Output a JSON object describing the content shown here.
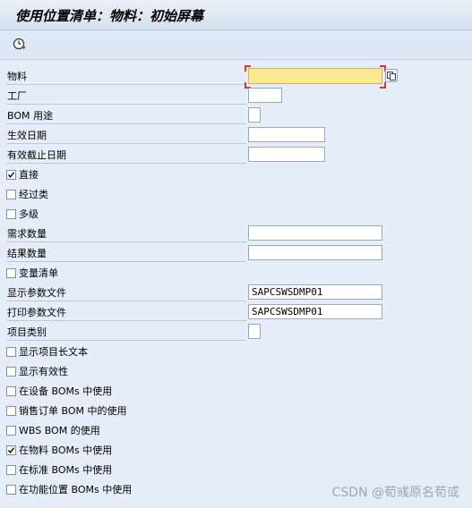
{
  "title": "使用位置清单：物料：初始屏幕",
  "toolbar": {
    "execute_icon": "execute-clock-icon"
  },
  "fields": {
    "material": {
      "label": "物料",
      "value": ""
    },
    "plant": {
      "label": "工厂",
      "value": ""
    },
    "bom_usage": {
      "label": "BOM 用途",
      "value": ""
    },
    "valid_from": {
      "label": "生效日期",
      "value": ""
    },
    "valid_to": {
      "label": "有效截止日期",
      "value": ""
    },
    "direct": {
      "label": "直接",
      "checked": true
    },
    "via_class": {
      "label": "经过类",
      "checked": false
    },
    "multilevel": {
      "label": "多级",
      "checked": false
    },
    "required_qty": {
      "label": "需求数量",
      "value": ""
    },
    "result_qty": {
      "label": "结果数量",
      "value": ""
    },
    "variant_bom": {
      "label": "变量清单",
      "checked": false
    },
    "display_profile": {
      "label": "显示参数文件",
      "value": "SAPCSWSDMP01"
    },
    "print_profile": {
      "label": "打印参数文件",
      "value": "SAPCSWSDMP01"
    },
    "item_category": {
      "label": "项目类别",
      "value": ""
    },
    "show_long_text": {
      "label": "显示项目长文本",
      "checked": false
    },
    "show_validity": {
      "label": "显示有效性",
      "checked": false
    },
    "equipment_boms": {
      "label": "在设备 BOMs 中使用",
      "checked": false
    },
    "sales_order_bom": {
      "label": "销售订单 BOM 中的使用",
      "checked": false
    },
    "wbs_bom": {
      "label": "WBS BOM 的使用",
      "checked": false
    },
    "material_boms": {
      "label": "在物料 BOMs 中使用",
      "checked": true
    },
    "standard_boms": {
      "label": "在标准 BOMs 中使用",
      "checked": false
    },
    "func_loc_boms": {
      "label": "在功能位置 BOMs 中使用",
      "checked": false
    }
  },
  "watermark": "CSDN @荀彧原名荀或"
}
